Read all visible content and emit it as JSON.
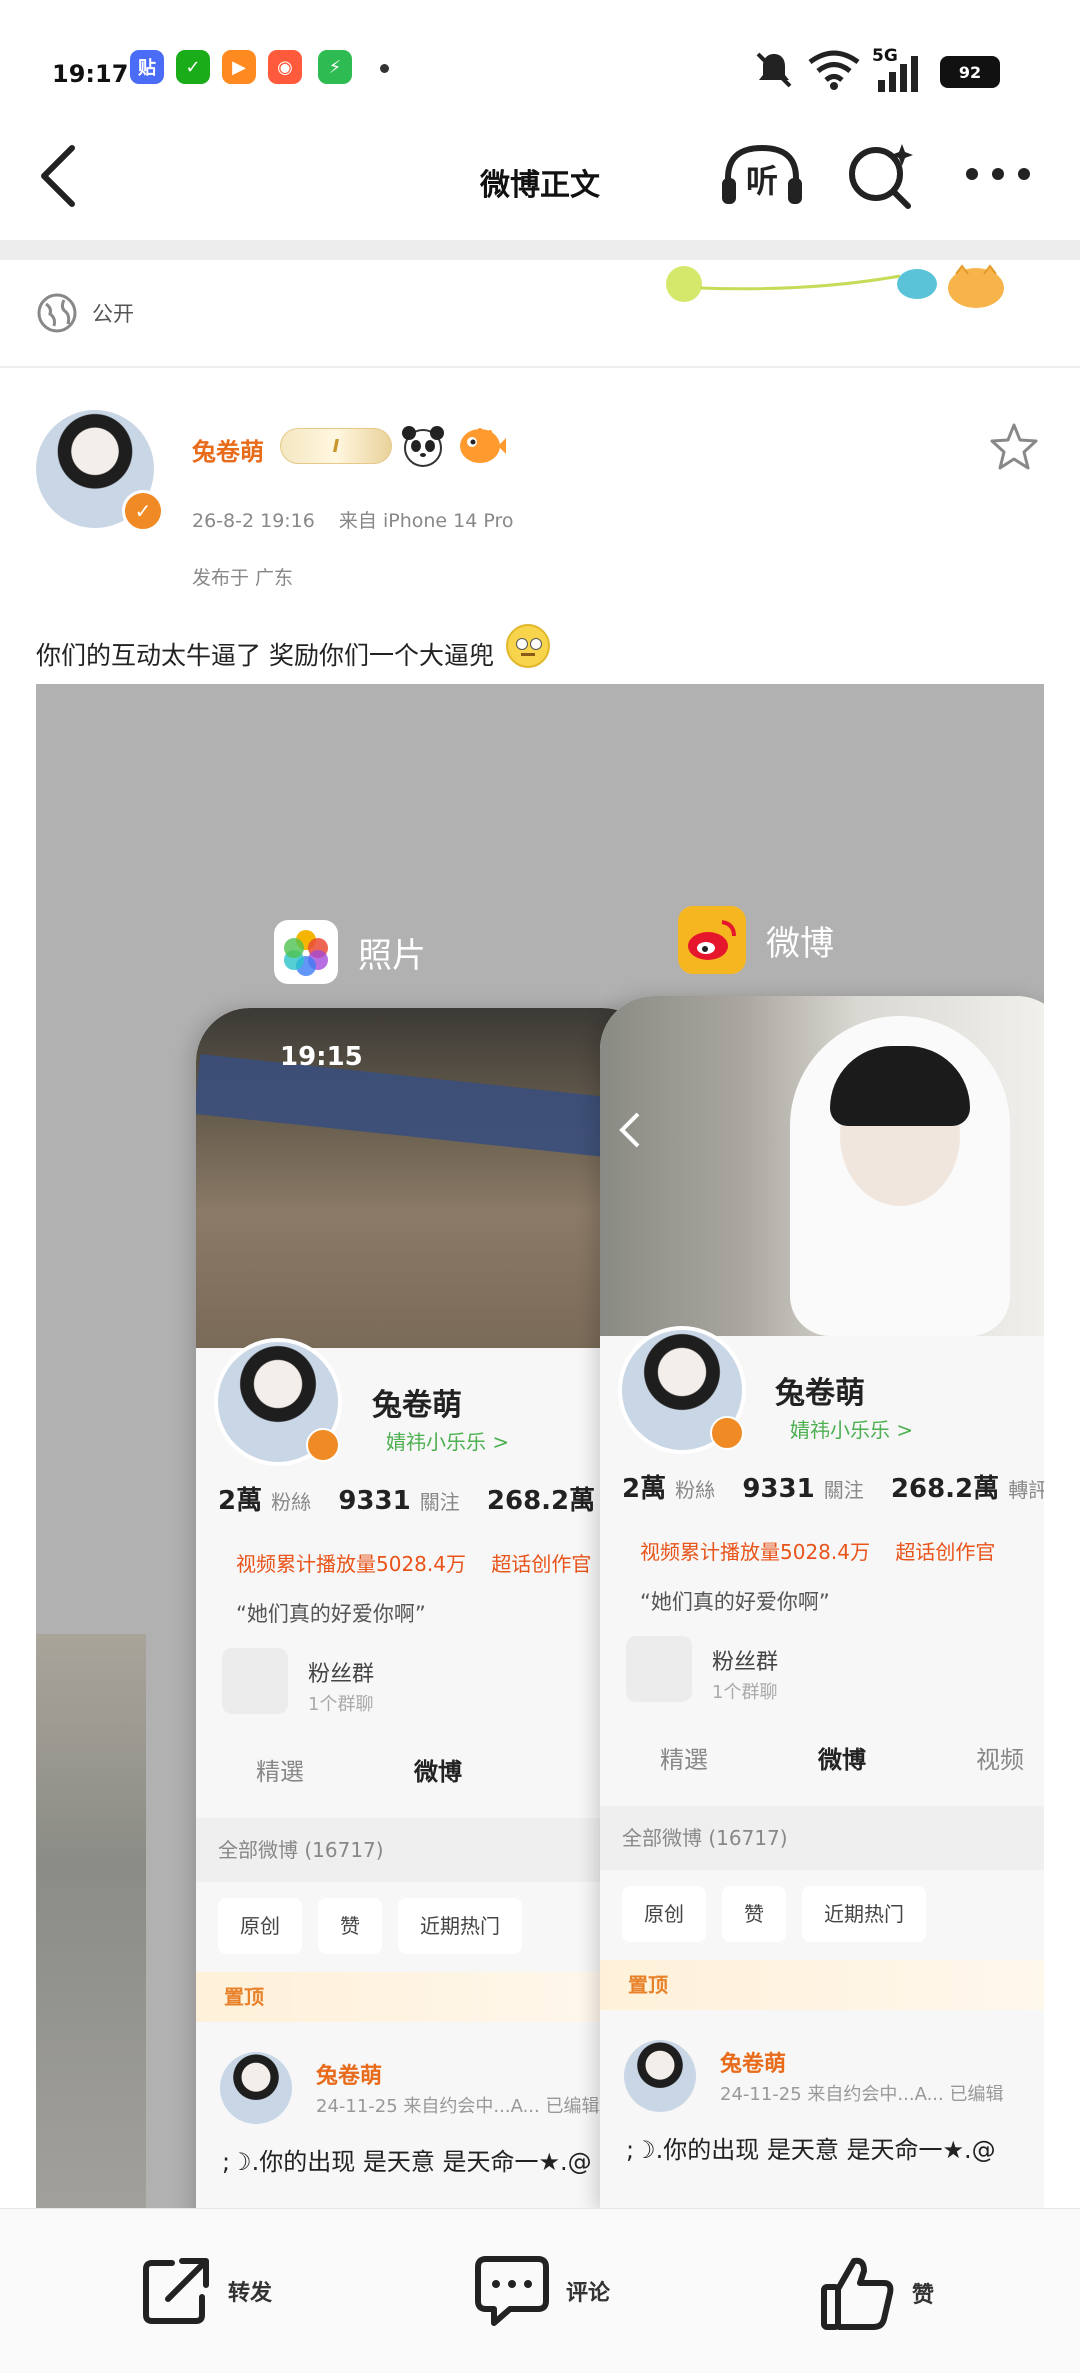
{
  "status_bar": {
    "time": "19:17",
    "app_icons": [
      {
        "name": "tieba-app-icon",
        "glyph": "贴",
        "color": "#4a6cf7"
      },
      {
        "name": "wechat-app-icon",
        "glyph": "✓",
        "color": "#1aad19"
      },
      {
        "name": "video-app-icon",
        "glyph": "▶",
        "color": "#ff8a1f"
      },
      {
        "name": "camera-app-icon",
        "glyph": "◉",
        "color": "#ff5a3c"
      },
      {
        "name": "shield-app-icon",
        "glyph": "⚡",
        "color": "#2dbb52"
      }
    ],
    "network": "5G",
    "battery": "92"
  },
  "nav": {
    "title": "微博正文",
    "listen_label": "听"
  },
  "visibility": {
    "label": "公开"
  },
  "post": {
    "author": "兔卷萌",
    "vip_badge": "I",
    "time": "26-8-2 19:16",
    "source": "来自 iPhone 14 Pro",
    "location": "发布于 广东",
    "text": "你们的互动太牛逼了 奖励你们一个大逼兜"
  },
  "screenshot": {
    "photos_app_label": "照片",
    "weibo_app_label": "微博",
    "time": "19:15",
    "profile": {
      "name": "兔卷萌",
      "subtitle": "婧祎小乐乐 >",
      "fans_num": "2萬",
      "fans_label": "粉絲",
      "following_num": "9331",
      "following_label": "關注",
      "reposts_num": "268.2萬",
      "reposts_label": "轉評",
      "views": "视频累计播放量5028.4万",
      "creator": "超话创作官",
      "quote": "“她们真的好爱你啊”",
      "fans_group": "粉丝群",
      "fans_group_sub": "1个群聊",
      "tab_featured": "精選",
      "tab_weibo": "微博",
      "tab_video": "视频",
      "all_weibo": "全部微博 (16717)",
      "filter_original": "原创",
      "filter_liked": "赞",
      "filter_recent": "近期热门",
      "pinned": "置顶",
      "post_author": "兔卷萌",
      "post_meta": "24-11-25  来自约会中...A... 已编辑",
      "post_text": ";☽.你的出现 是天意 是天命一★.@"
    }
  },
  "bottom_bar": {
    "repost": "转发",
    "comment": "评论",
    "like": "赞"
  }
}
